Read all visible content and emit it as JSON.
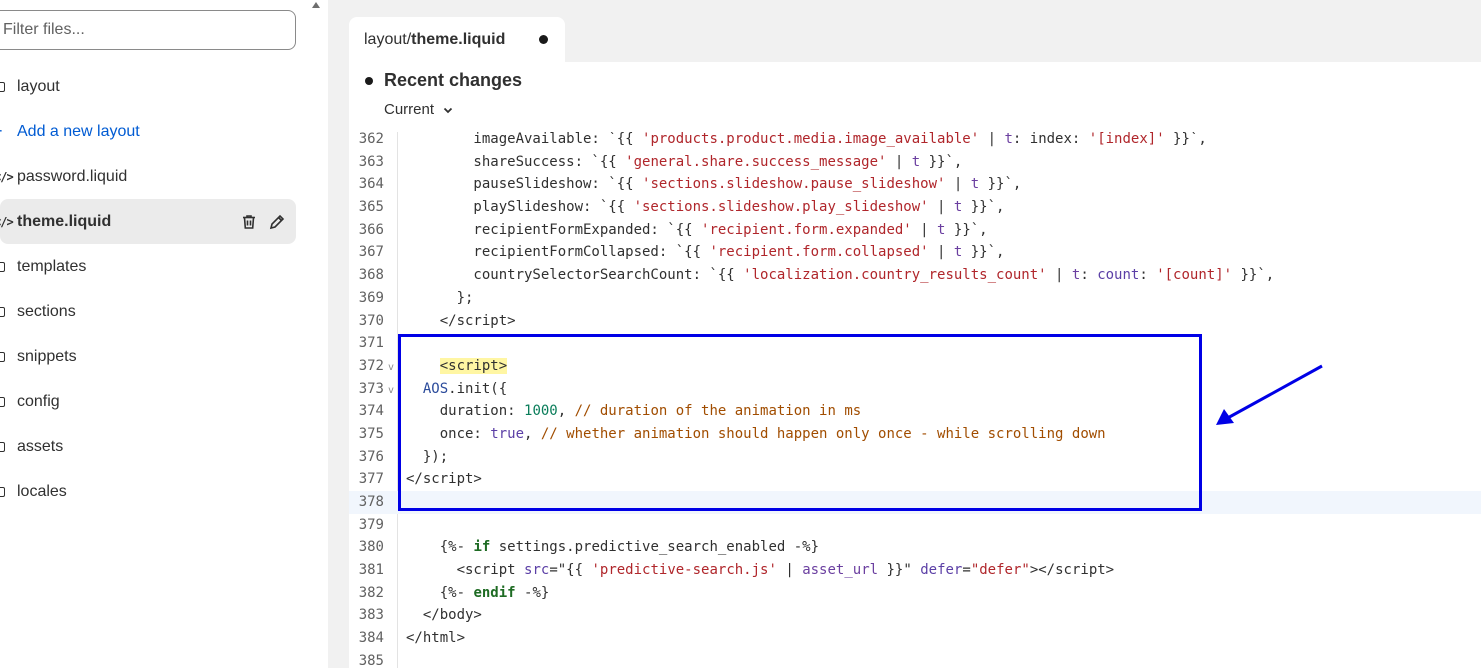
{
  "sidebar": {
    "filter_placeholder": "Filter files...",
    "items": [
      {
        "label": "layout",
        "icon": "folder-icon"
      },
      {
        "label": "Add a new layout",
        "icon": "plus-icon"
      },
      {
        "label": "password.liquid",
        "icon": "code-file-icon"
      },
      {
        "label": "theme.liquid",
        "icon": "code-file-icon",
        "active": true
      },
      {
        "label": "templates",
        "icon": "folder-icon"
      },
      {
        "label": "sections",
        "icon": "folder-icon"
      },
      {
        "label": "snippets",
        "icon": "folder-icon"
      },
      {
        "label": "config",
        "icon": "folder-icon"
      },
      {
        "label": "assets",
        "icon": "folder-icon"
      },
      {
        "label": "locales",
        "icon": "folder-icon"
      }
    ],
    "row_icons": [
      "trash-icon",
      "pencil-icon"
    ]
  },
  "tab": {
    "path_prefix": "layout/",
    "file_name": "theme.liquid",
    "unsaved_indicator": "dot"
  },
  "changes": {
    "title": "Recent changes",
    "version_label": "Current"
  },
  "code": {
    "current_line": "378",
    "line_numbers": [
      "362",
      "363",
      "364",
      "365",
      "366",
      "367",
      "368",
      "369",
      "370",
      "371",
      "372",
      "373",
      "374",
      "375",
      "376",
      "377",
      "378",
      "379",
      "380",
      "381",
      "382",
      "383",
      "384",
      "385"
    ]
  },
  "colors": {
    "accent_link": "#005bd3",
    "highlight_box": "#0000e6",
    "arrow": "#0000e6"
  }
}
